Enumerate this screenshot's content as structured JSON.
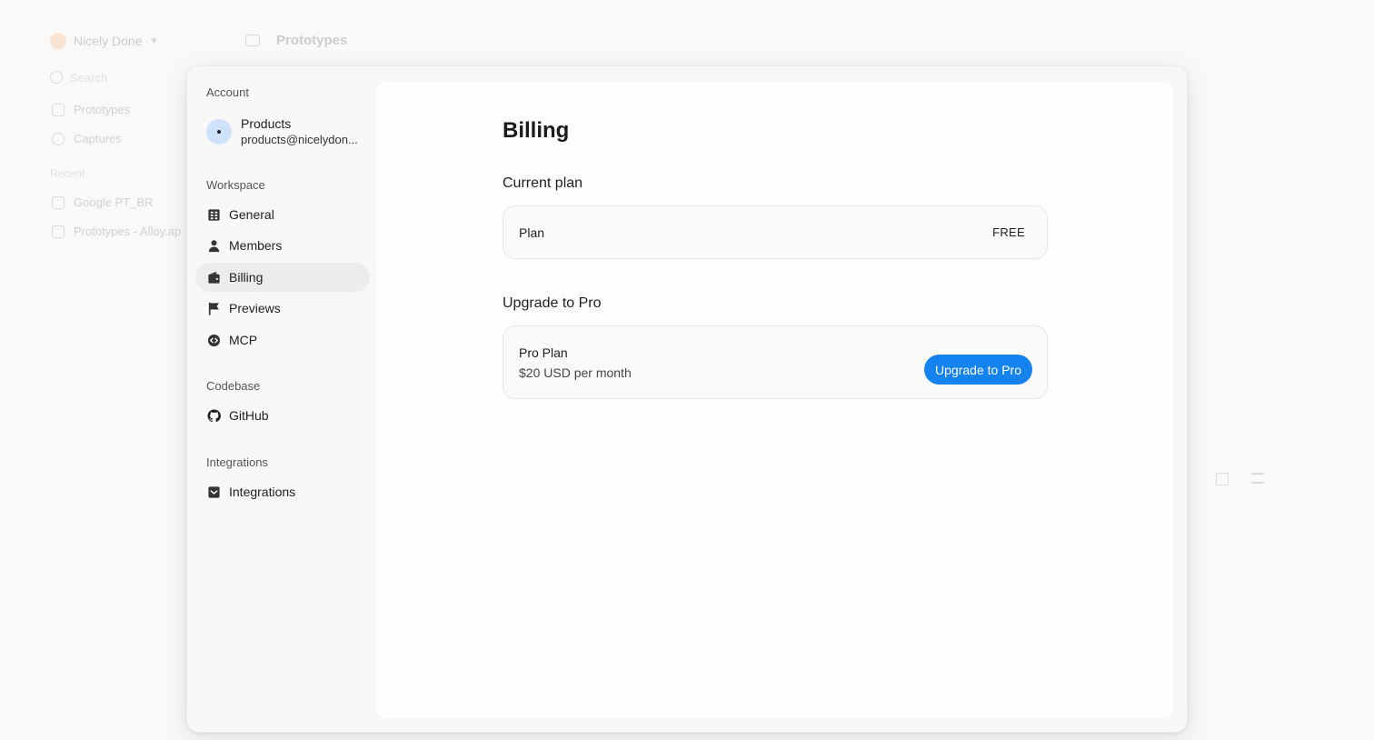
{
  "background": {
    "workspace_name": "Nicely Done",
    "search_placeholder": "Search",
    "nav": [
      {
        "label": "Prototypes",
        "icon": "cube-icon"
      },
      {
        "label": "Captures",
        "icon": "camera-icon"
      }
    ],
    "recent_label": "Recent",
    "recent": [
      {
        "label": "Google PT_BR",
        "icon": "layers-icon"
      },
      {
        "label": "Prototypes - Alloy.ap",
        "icon": "rocket-icon"
      }
    ],
    "page_title": "Prototypes"
  },
  "sidebar": {
    "account_label": "Account",
    "account": {
      "name": "Products",
      "email": "products@nicelydon..."
    },
    "workspace_label": "Workspace",
    "workspace_items": [
      {
        "label": "General",
        "icon": "building-icon"
      },
      {
        "label": "Members",
        "icon": "person-icon"
      },
      {
        "label": "Billing",
        "icon": "wallet-icon",
        "active": true
      },
      {
        "label": "Previews",
        "icon": "flag-icon"
      },
      {
        "label": "MCP",
        "icon": "code-icon"
      }
    ],
    "codebase_label": "Codebase",
    "codebase_items": [
      {
        "label": "GitHub",
        "icon": "github-icon"
      }
    ],
    "integrations_label": "Integrations",
    "integrations_items": [
      {
        "label": "Integrations",
        "icon": "integration-icon"
      }
    ]
  },
  "billing": {
    "title": "Billing",
    "current_plan_heading": "Current plan",
    "plan_label": "Plan",
    "plan_value": "FREE",
    "upgrade_heading": "Upgrade to Pro",
    "pro_plan_name": "Pro Plan",
    "pro_plan_price": "$20 USD per month",
    "upgrade_button": "Upgrade to Pro"
  },
  "colors": {
    "accent": "#1483f0",
    "avatar_bg": "#cfe2fb",
    "active_nav_bg": "#ececeb"
  }
}
